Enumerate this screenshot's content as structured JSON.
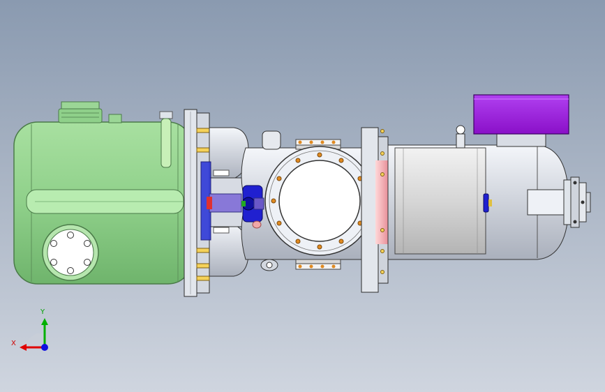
{
  "colors": {
    "receiver_body": "#8fd08a",
    "receiver_edge": "#4a7a48",
    "steel_light": "#e9ecf2",
    "steel_mid": "#c3c8d2",
    "steel_dark": "#5f6570",
    "terminal_box": "#a020e0",
    "bolt_orange": "#e08a20",
    "coupling_blue": "#2020d0",
    "coupling_purple": "#6a58c8",
    "pink_seal": "#f0a8a8",
    "axis_x": "#e00000",
    "axis_y": "#00b000",
    "axis_z": "#1010e0"
  },
  "triad": {
    "x_label": "X",
    "y_label": "Y"
  }
}
